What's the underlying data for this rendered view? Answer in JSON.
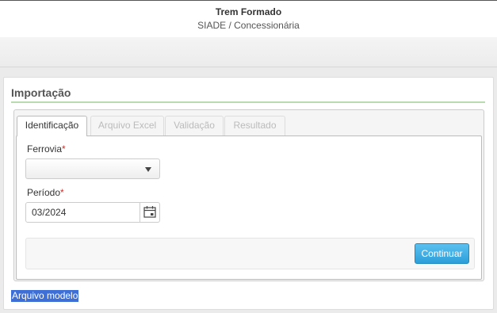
{
  "header": {
    "title": "Trem Formado",
    "subtitle": "SIADE / Concessionária"
  },
  "panel": {
    "title": "Importação"
  },
  "tabs": [
    {
      "label": "Identificação",
      "active": true
    },
    {
      "label": "Arquivo Excel",
      "active": false
    },
    {
      "label": "Validação",
      "active": false
    },
    {
      "label": "Resultado",
      "active": false
    }
  ],
  "form": {
    "ferrovia_label": "Ferrovia",
    "ferrovia_value": "",
    "periodo_label": "Período",
    "periodo_value": "03/2024",
    "required_mark": "*"
  },
  "actions": {
    "continue_label": "Continuar"
  },
  "links": {
    "modelo_label": "Arquivo modelo"
  },
  "colors": {
    "accent": "#2d9fd9",
    "required": "#c9302c",
    "section_rule": "#b9dbb0",
    "link_highlight": "#3d6fd6"
  },
  "icons": {
    "calendar": "calendar-icon",
    "dropdown": "chevron-down-icon"
  }
}
